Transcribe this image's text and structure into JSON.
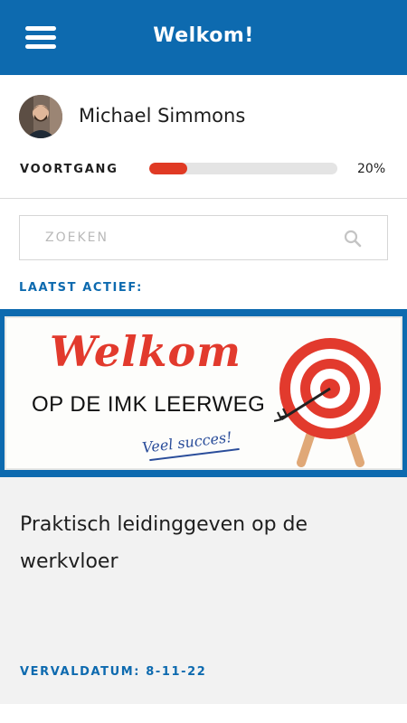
{
  "header": {
    "title": "Welkom!",
    "menu_icon": "hamburger-menu-icon"
  },
  "profile": {
    "name": "Michael Simmons",
    "progress_label": "VOORTGANG",
    "progress_value": "20%",
    "progress_fraction": 0.2,
    "progress_color": "#e03a24"
  },
  "search": {
    "placeholder": "ZOEKEN",
    "value": "",
    "icon": "search-icon"
  },
  "recent": {
    "label": "LAATST ACTIEF:"
  },
  "course_card": {
    "banner": {
      "title": "Welkom",
      "subtitle": "OP DE IMK LEERWEG",
      "tagline": "Veel succes!"
    },
    "title": "Praktisch leidinggeven op de werkvloer",
    "due_date": "VERVALDATUM: 8-11-22"
  },
  "colors": {
    "primary": "#0d6aaf",
    "accent": "#e03a24",
    "card_background": "#f2f2f2"
  }
}
